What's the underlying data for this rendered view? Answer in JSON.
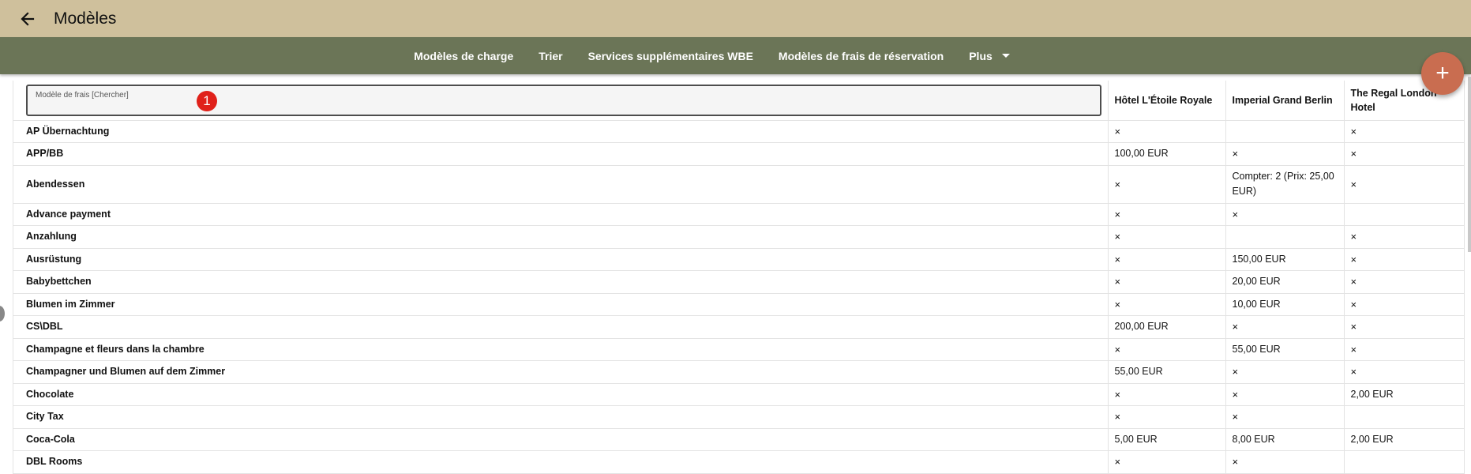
{
  "header": {
    "title": "Modèles",
    "back_icon": "arrow-left-icon"
  },
  "nav": {
    "items": [
      {
        "label": "Modèles de charge"
      },
      {
        "label": "Trier"
      },
      {
        "label": "Services supplémentaires WBE"
      },
      {
        "label": "Modèles de frais de réservation"
      }
    ],
    "more_label": "Plus"
  },
  "fab": {
    "label": "+"
  },
  "search": {
    "label": "Modèle de frais [Chercher]",
    "value": "",
    "badge": "1"
  },
  "columns": [
    "Hôtel L'Étoile Royale",
    "Imperial Grand Berlin",
    "The Regal London Hotel"
  ],
  "rows": [
    {
      "name": "AP Übernachtung",
      "cells": [
        "×",
        "",
        "×"
      ]
    },
    {
      "name": "APP/BB",
      "cells": [
        "100,00 EUR",
        "×",
        "×"
      ]
    },
    {
      "name": "Abendessen",
      "cells": [
        "×",
        "Compter: 2 (Prix: 25,00 EUR)",
        "×"
      ]
    },
    {
      "name": "Advance payment",
      "cells": [
        "×",
        "×",
        ""
      ]
    },
    {
      "name": "Anzahlung",
      "cells": [
        "×",
        "",
        "×"
      ]
    },
    {
      "name": "Ausrüstung",
      "cells": [
        "×",
        "150,00 EUR",
        "×"
      ]
    },
    {
      "name": "Babybettchen",
      "cells": [
        "×",
        "20,00 EUR",
        "×"
      ]
    },
    {
      "name": "Blumen im Zimmer",
      "cells": [
        "×",
        "10,00 EUR",
        "×"
      ]
    },
    {
      "name": "CS\\DBL",
      "cells": [
        "200,00 EUR",
        "×",
        "×"
      ]
    },
    {
      "name": "Champagne et fleurs dans la chambre",
      "cells": [
        "×",
        "55,00 EUR",
        "×"
      ]
    },
    {
      "name": "Champagner und Blumen auf dem Zimmer",
      "cells": [
        "55,00 EUR",
        "×",
        "×"
      ]
    },
    {
      "name": "Chocolate",
      "cells": [
        "×",
        "×",
        "2,00 EUR"
      ]
    },
    {
      "name": "City Tax",
      "cells": [
        "×",
        "×",
        ""
      ]
    },
    {
      "name": "Coca-Cola",
      "cells": [
        "5,00 EUR",
        "8,00 EUR",
        "2,00 EUR"
      ]
    },
    {
      "name": "DBL Rooms",
      "cells": [
        "×",
        "×",
        ""
      ]
    }
  ],
  "colors": {
    "appbar": "#cfc09c",
    "navbar": "#6b7557",
    "fab": "#c96d50",
    "badge": "#e0211a"
  }
}
